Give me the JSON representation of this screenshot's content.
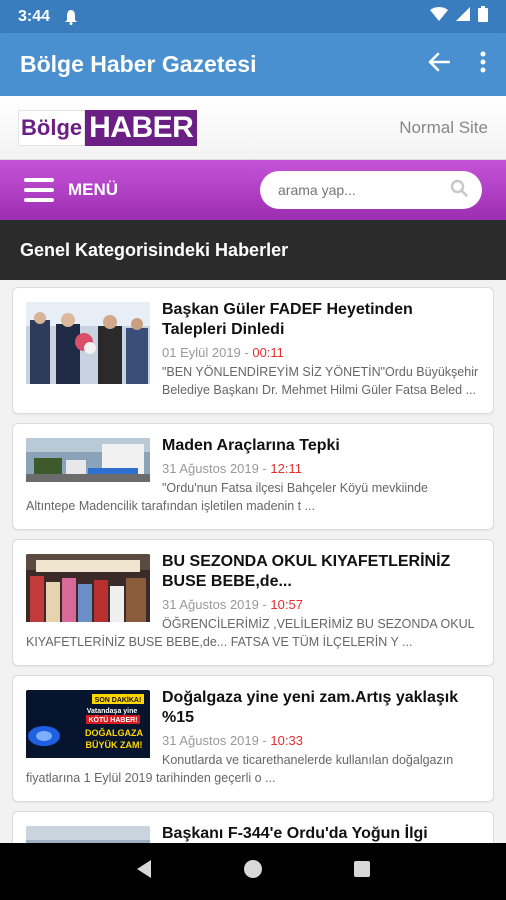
{
  "status": {
    "time": "3:44"
  },
  "app_bar": {
    "title": "Bölge Haber Gazetesi"
  },
  "site": {
    "logo_part1": "Bölge",
    "logo_part2": "HABER",
    "normal_site_label": "Normal Site"
  },
  "menu": {
    "label": "MENÜ",
    "search_placeholder": "arama yap..."
  },
  "section": {
    "title": "Genel Kategorisindeki Haberler"
  },
  "articles": [
    {
      "title": "Başkan Güler FADEF Heyetinden Talepleri Dinledi",
      "date": "01 Eylül 2019",
      "time": "00:11",
      "summary": "\"BEN YÖNLENDİREYİM SİZ YÖNETİN\"Ordu Büyükşehir Belediye Başkanı Dr. Mehmet Hilmi Güler Fatsa Beled ..."
    },
    {
      "title": "Maden Araçlarına Tepki",
      "date": "31 Ağustos 2019",
      "time": "12:11",
      "summary": "\"Ordu'nun Fatsa ilçesi Bahçeler Köyü mevkiinde Altıntepe Madencilik tarafından işletilen madenin t ..."
    },
    {
      "title": "BU SEZONDA OKUL KIYAFETLERİNİZ BUSE BEBE,de...",
      "date": "31 Ağustos 2019",
      "time": "10:57",
      "summary": "ÖĞRENCİLERİMİZ ,VELİLERİMİZ BU SEZONDA OKUL KIYAFETLERİNİZ BUSE BEBE,de... FATSA VE TÜM İLÇELERİN Y ..."
    },
    {
      "title": "Doğalgaza yine yeni zam.Artış yaklaşık %15",
      "date": "31 Ağustos 2019",
      "time": "10:33",
      "summary": "Konutlarda ve ticarethanelerde kullanılan doğalgazın fiyatlarına 1 Eylül 2019 tarihinden geçerli o ..."
    },
    {
      "title": "Başkanı F-344'e Ordu'da Yoğun İlgi",
      "date": "",
      "time": "",
      "summary": ""
    }
  ],
  "thumb_texts": {
    "gas": {
      "line1": "SON DAKİKA!",
      "line2": "Vatandaşa yine",
      "line3": "KÖTÜ HABER!",
      "line4": "DOĞALGAZA",
      "line5": "BÜYÜK ZAM!"
    }
  },
  "colors": {
    "status_bar": "#3a7dbf",
    "app_bar": "#4a90d0",
    "menu_bar": "#b041c6",
    "logo": "#6b1f84",
    "section_head": "#2b2b2b",
    "time_accent": "#e03030"
  }
}
